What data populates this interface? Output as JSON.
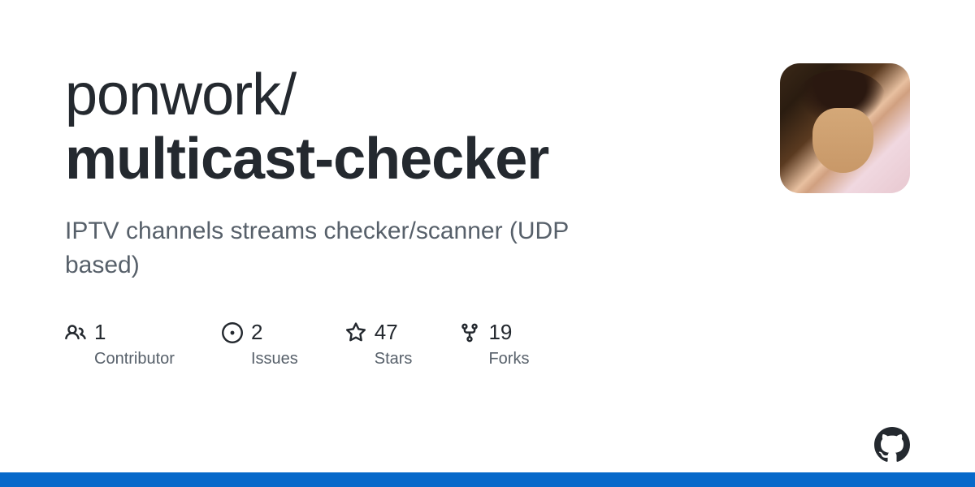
{
  "repo": {
    "owner": "ponwork",
    "name": "multicast-checker",
    "description": "IPTV channels streams checker/scanner (UDP based)"
  },
  "stats": {
    "contributors": {
      "count": "1",
      "label": "Contributor"
    },
    "issues": {
      "count": "2",
      "label": "Issues"
    },
    "stars": {
      "count": "47",
      "label": "Stars"
    },
    "forks": {
      "count": "19",
      "label": "Forks"
    }
  }
}
